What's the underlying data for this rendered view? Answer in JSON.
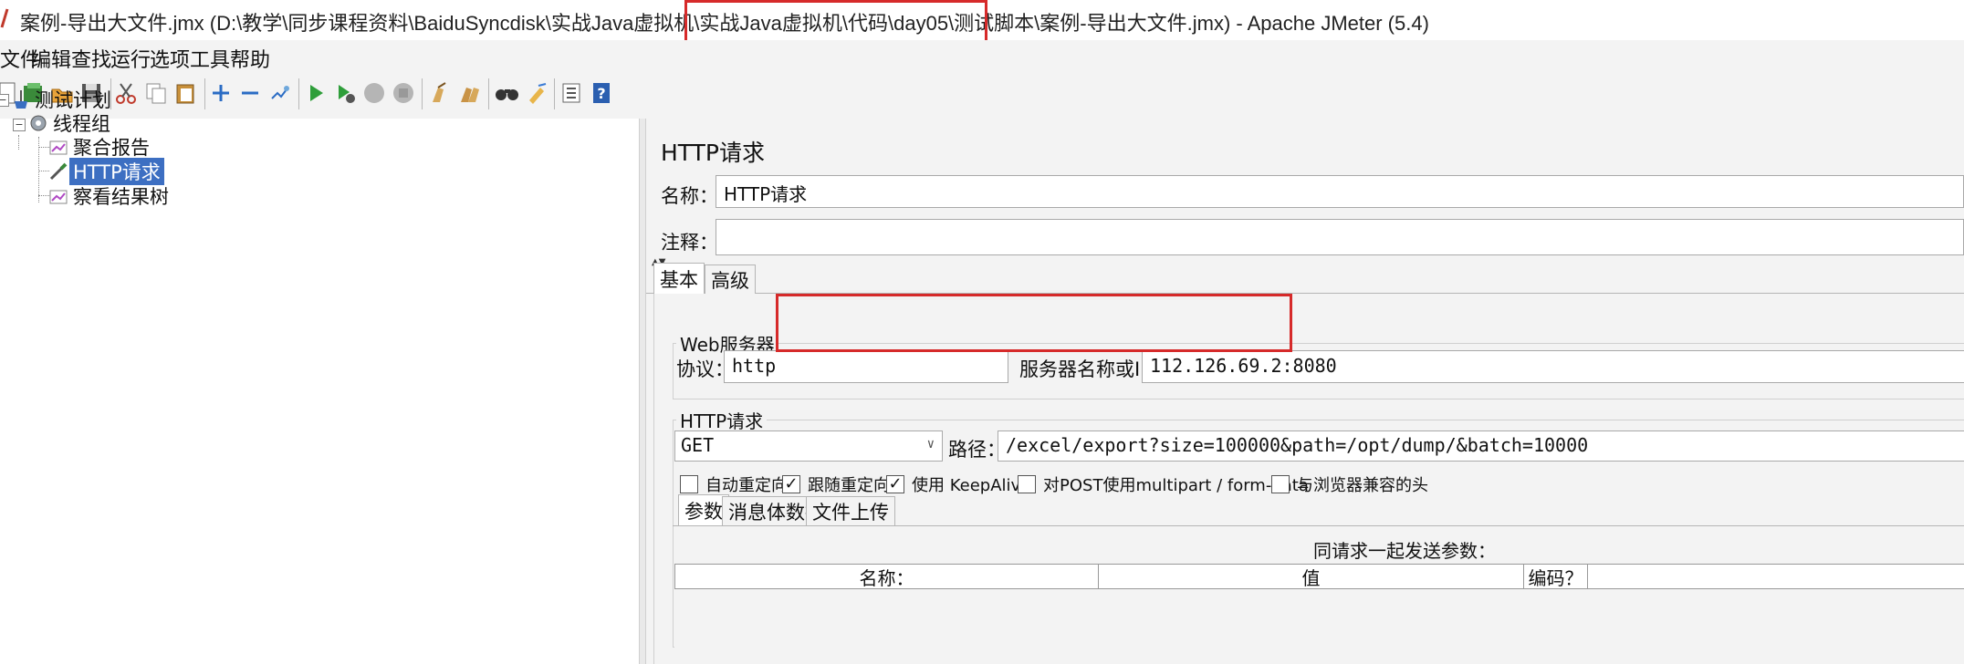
{
  "window": {
    "title": "案例-导出大文件.jmx (D:\\教学\\同步课程资料\\BaiduSyncdisk\\实战Java虚拟机\\实战Java虚拟机\\代码\\day05\\测试脚本\\案例-导出大文件.jmx) - Apache JMeter (5.4)"
  },
  "menu": [
    "文件",
    "编辑",
    "查找",
    "运行",
    "选项",
    "工具",
    "帮助"
  ],
  "toolbar": {
    "icons": [
      "new-icon",
      "templates-icon",
      "open-icon",
      "save-icon",
      "cut-icon",
      "copy-icon",
      "paste-icon",
      "expand-icon",
      "collapse-icon",
      "toggle-icon",
      "start-icon",
      "start-no-pause-icon",
      "stop-icon",
      "shutdown-icon",
      "clear-icon",
      "clear-all-icon",
      "search-icon",
      "reset-search-icon",
      "function-helper-icon",
      "help-icon"
    ]
  },
  "tree": {
    "items": [
      {
        "label": "测试计划"
      },
      {
        "label": "线程组"
      },
      {
        "label": "聚合报告"
      },
      {
        "label": "HTTP请求"
      },
      {
        "label": "察看结果树"
      }
    ]
  },
  "panel": {
    "heading": "HTTP请求",
    "name_label": "名称：",
    "name_value": "HTTP请求",
    "comment_label": "注释：",
    "comment_value": "",
    "tabs": [
      "基本",
      "高级"
    ],
    "web_server": {
      "group_title": "Web服务器",
      "protocol_label": "协议：",
      "protocol_value": "http",
      "server_label": "服务器名称或IP：",
      "server_value": "112.126.69.2:8080"
    },
    "http_request": {
      "group_title": "HTTP请求",
      "method_value": "GET",
      "path_label": "路径：",
      "path_value": "/excel/export?size=100000&path=/opt/dump/&batch=10000"
    },
    "checkboxes": [
      {
        "label": "自动重定向",
        "checked": false
      },
      {
        "label": "跟随重定向",
        "checked": true
      },
      {
        "label": "使用 KeepAlive",
        "checked": true
      },
      {
        "label": "对POST使用multipart / form-data",
        "checked": false
      },
      {
        "label": "与浏览器兼容的头",
        "checked": false
      }
    ],
    "subtabs": [
      "参数",
      "消息体数据",
      "文件上传"
    ],
    "params_caption": "同请求一起发送参数：",
    "table_headers": [
      "名称：",
      "值",
      "编码？"
    ]
  },
  "colors": {
    "highlight_box": "#d62a2a",
    "selection": "#3d6fc2"
  }
}
